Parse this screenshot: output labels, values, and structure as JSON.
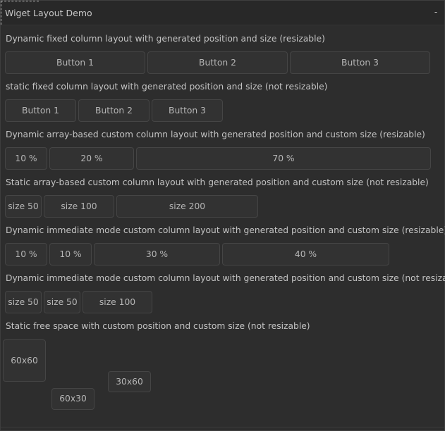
{
  "window": {
    "title": "Wiget Layout Demo",
    "minimize_label": "-"
  },
  "sections": [
    {
      "label": "Dynamic fixed column layout with generated position and size (resizable)",
      "buttons": [
        "Button 1",
        "Button 2",
        "Button 3"
      ]
    },
    {
      "label": "static fixed column layout with generated position and size (not resizable)",
      "buttons": [
        "Button 1",
        "Button 2",
        "Button 3"
      ]
    },
    {
      "label": "Dynamic array-based custom column layout with generated position and custom size (resizable)",
      "buttons": [
        "10 %",
        "20 %",
        "70 %"
      ]
    },
    {
      "label": "Static array-based custom column layout with generated position and custom size (not resizable)",
      "buttons": [
        "size 50",
        "size 100",
        "size 200"
      ]
    },
    {
      "label": "Dynamic immediate mode custom column layout with generated position and custom size (resizable)",
      "buttons": [
        "10 %",
        "10 %",
        "30 %",
        "40 %"
      ]
    },
    {
      "label": "Dynamic immediate mode custom column layout with generated position and custom size (not resizable)",
      "buttons": [
        "size 50",
        "size 50",
        "size 100"
      ]
    },
    {
      "label": "Static free space with custom position and custom size (not resizable)",
      "buttons": [
        "60x60",
        "30x60",
        "60x30"
      ]
    }
  ]
}
